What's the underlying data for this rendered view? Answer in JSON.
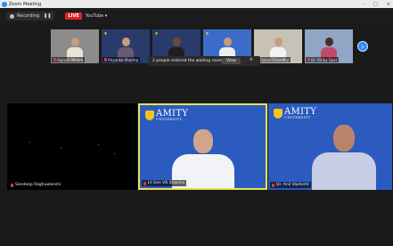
{
  "window": {
    "title": "Zoom Meeting"
  },
  "recording": {
    "label": "Recording"
  },
  "live": {
    "badge": "LIVE",
    "platform": "YouTube"
  },
  "thumbnails": [
    {
      "name": "Rajnish Mishra"
    },
    {
      "name": "Priyanka Sharma"
    },
    {
      "name": ""
    },
    {
      "name": ""
    },
    {
      "name": "Rahul Chaudhry"
    },
    {
      "name": "Dr. Ritika Goel"
    }
  ],
  "toast": {
    "message": "2 people entered the waiting room",
    "view_label": "View",
    "close": "×"
  },
  "tiles": [
    {
      "name": "Sandeep Raghuwanshi"
    },
    {
      "name": "Lt Gen VK Sharma",
      "brand": "AMITY",
      "brand_sub": "UNIVERSITY"
    },
    {
      "name": "Dr. Anil Vashisht",
      "brand": "AMITY",
      "brand_sub": "UNIVERSITY"
    }
  ],
  "colors": {
    "zoom_blue": "#2d8cff",
    "live_red": "#e02424",
    "speaker_border": "#e8e25a",
    "amity_blue": "#2b5bbf"
  }
}
